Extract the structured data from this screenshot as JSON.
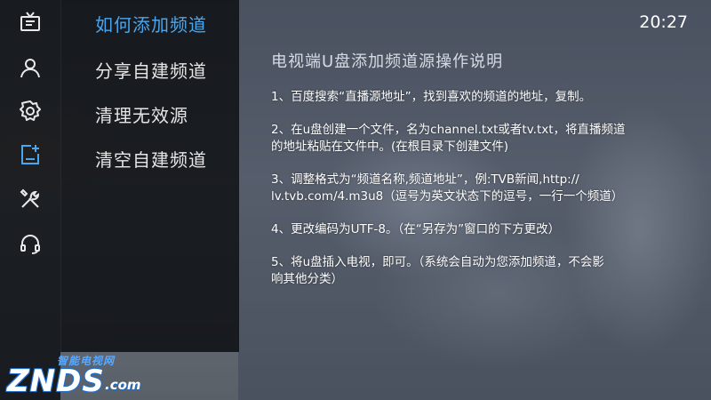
{
  "sidebar": {
    "icons": [
      {
        "name": "tv-icon"
      },
      {
        "name": "user-icon"
      },
      {
        "name": "settings-icon"
      },
      {
        "name": "add-channel-icon"
      },
      {
        "name": "tools-icon"
      },
      {
        "name": "headset-icon"
      }
    ],
    "active_color": "#4aa6ee"
  },
  "menu": {
    "items": [
      {
        "label": "如何添加频道",
        "active": true
      },
      {
        "label": "分享自建频道",
        "active": false
      },
      {
        "label": "清理无效源",
        "active": false
      },
      {
        "label": "清空自建频道",
        "active": false
      }
    ]
  },
  "status": {
    "time": "20:27"
  },
  "content": {
    "title": "电视端U盘添加频道源操作说明",
    "steps": [
      [
        "1、百度搜索“直播源地址”，找到喜欢的频道的地址，复制。"
      ],
      [
        "2、在u盘创建一个文件，名为channel.txt或者tv.txt，将直播频道",
        "的地址粘贴在文件中。(在根目录下创建文件)"
      ],
      [
        "3、调整格式为“频道名称,频道地址”，例:TVB新闻,http://",
        "lv.tvb.com/4.m3u8（逗号为英文状态下的逗号，一行一个频道）"
      ],
      [
        "4、更改编码为UTF-8。（在“另存为”窗口的下方更改）"
      ],
      [
        "5、将u盘插入电视，即可。（系统会自动为您添加频道，不会影",
        "响其他分类）"
      ]
    ]
  },
  "watermark": {
    "small": "智能电视网",
    "big": "ZNDS",
    "suffix": ".com"
  }
}
